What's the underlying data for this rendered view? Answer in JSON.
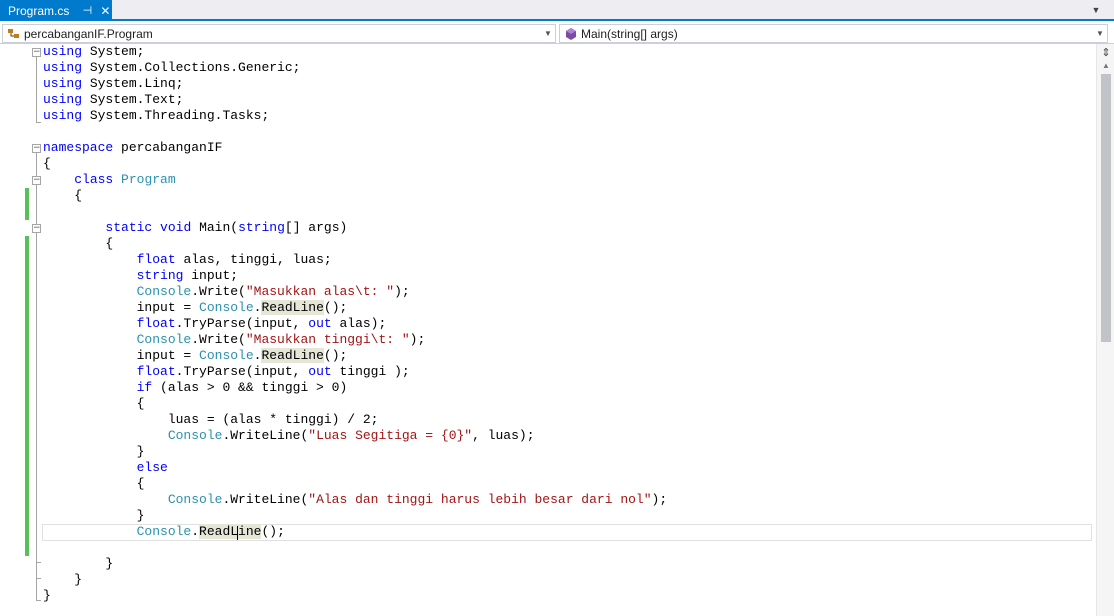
{
  "tabs": [
    {
      "label": "Program.cs",
      "pin_icon": "pin-icon",
      "close_icon": "close-icon",
      "active": true
    }
  ],
  "colors": {
    "accent": "#007acc",
    "keyword": "#0000ff",
    "type": "#2b91af",
    "string": "#a31515",
    "change_marker": "#57c157"
  },
  "navbar": {
    "type_selector": {
      "icon": "class-icon",
      "value": "percabanganIF.Program"
    },
    "member_selector": {
      "icon": "method-icon",
      "value": "Main(string[] args)"
    }
  },
  "code": {
    "l1": {
      "kw": "using",
      "rest": " System;"
    },
    "l2": {
      "kw": "using",
      "rest": " System.Collections.Generic;"
    },
    "l3": {
      "kw": "using",
      "rest": " System.Linq;"
    },
    "l4": {
      "kw": "using",
      "rest": " System.Text;"
    },
    "l5": {
      "kw": "using",
      "rest": " System.Threading.Tasks;"
    },
    "l7": {
      "kw": "namespace",
      "rest": " percabanganIF"
    },
    "l8": {
      "text": "{"
    },
    "l9": {
      "indent": "    ",
      "kw": "class",
      "type": "Program"
    },
    "l10": {
      "text": "    {"
    },
    "l12": {
      "indent": "        ",
      "kw1": "static",
      "kw2": "void",
      "name": " Main(",
      "kw3": "string",
      "rest": "[] args)"
    },
    "l13": {
      "text": "        {"
    },
    "l14": {
      "indent": "            ",
      "kw": "float",
      "rest": " alas, tinggi, luas;"
    },
    "l15": {
      "indent": "            ",
      "kw": "string",
      "rest": " input;"
    },
    "l16": {
      "indent": "            ",
      "type": "Console",
      "mid": ".Write(",
      "str": "\"Masukkan alas\\t: \"",
      "rest": ");"
    },
    "l17": {
      "indent": "            ",
      "pre": "input = ",
      "type": "Console",
      "dot": ".",
      "ref": "ReadLine",
      "rest": "();"
    },
    "l18": {
      "indent": "            ",
      "kw": "float",
      "mid": ".TryParse(input, ",
      "kw2": "out",
      "rest": " alas);"
    },
    "l19": {
      "indent": "            ",
      "type": "Console",
      "mid": ".Write(",
      "str": "\"Masukkan tinggi\\t: \"",
      "rest": ");"
    },
    "l20": {
      "indent": "            ",
      "pre": "input = ",
      "type": "Console",
      "dot": ".",
      "ref": "ReadLine",
      "rest": "();"
    },
    "l21": {
      "indent": "            ",
      "kw": "float",
      "mid": ".TryParse(input, ",
      "kw2": "out",
      "rest": " tinggi );"
    },
    "l22": {
      "indent": "            ",
      "kw": "if",
      "rest": " (alas > 0 && tinggi > 0)"
    },
    "l23": {
      "text": "            {"
    },
    "l24": {
      "text": "                luas = (alas * tinggi) / 2;"
    },
    "l25": {
      "indent": "                ",
      "type": "Console",
      "mid": ".WriteLine(",
      "str": "\"Luas Segitiga = {0}\"",
      "rest": ", luas);"
    },
    "l26": {
      "text": "            }"
    },
    "l27": {
      "indent": "            ",
      "kw": "else"
    },
    "l28": {
      "text": "            {"
    },
    "l29": {
      "indent": "                ",
      "type": "Console",
      "mid": ".WriteLine(",
      "str": "\"Alas dan tinggi harus lebih besar dari nol\"",
      "rest": ");"
    },
    "l30": {
      "text": "            }"
    },
    "l31": {
      "indent": "            ",
      "type": "Console",
      "dot": ".",
      "ref": "ReadLine",
      "rest": "();"
    },
    "l33": {
      "text": "        }"
    },
    "l34": {
      "text": "    }"
    },
    "l35": {
      "text": "}"
    }
  },
  "scrollbar": {
    "split_icon": "split-icon",
    "up_icon": "scroll-up-icon",
    "position_fraction": 0.0,
    "visible_fraction": 0.47
  }
}
